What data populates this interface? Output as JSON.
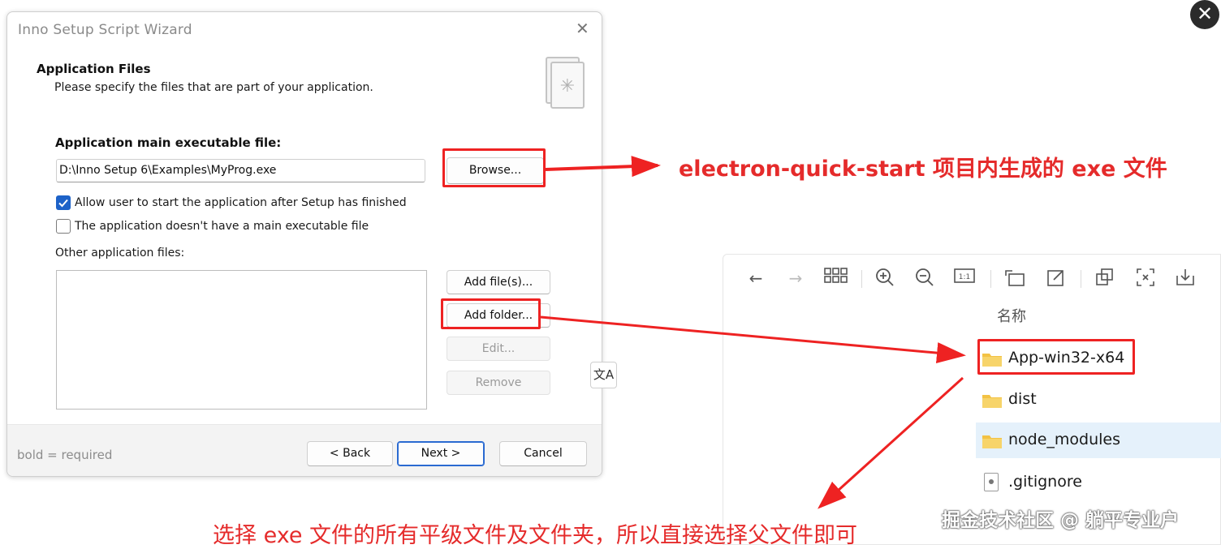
{
  "dialog": {
    "title": "Inno Setup Script Wizard",
    "close_glyph": "✕",
    "section_title": "Application Files",
    "section_subtitle": "Please specify the files that are part of your application.",
    "main_exe_label": "Application main executable file:",
    "main_exe_value": "D:\\Inno Setup 6\\Examples\\MyProg.exe",
    "browse_label": "Browse...",
    "allow_start_label": "Allow user to start the application after Setup has finished",
    "allow_start_checked": true,
    "no_main_exe_label": "The application doesn't have a main executable file",
    "no_main_exe_checked": false,
    "other_files_label": "Other application files:",
    "add_files_label": "Add file(s)...",
    "add_folder_label": "Add folder...",
    "edit_label": "Edit...",
    "remove_label": "Remove",
    "footer_hint": "bold = required",
    "back_label": "< Back",
    "next_label": "Next >",
    "cancel_label": "Cancel"
  },
  "translate_chip": "文A",
  "close_overlay_glyph": "✕",
  "annotations": {
    "browse_note": "electron-quick-start 项目内生成的 exe 文件",
    "folder_note": "选择 exe 文件的所有平级文件及文件夹，所以直接选择父文件即可"
  },
  "explorer": {
    "column_header": "名称",
    "toolbar_icons": [
      "back-icon",
      "forward-icon",
      "grid-view-icon",
      "zoom-in-icon",
      "zoom-out-icon",
      "actual-size-icon",
      "rotate-icon",
      "edit-icon",
      "copy-icon",
      "fit-icon",
      "download-icon"
    ],
    "items": [
      {
        "name": "App-win32-x64",
        "type": "folder",
        "selected": false
      },
      {
        "name": "dist",
        "type": "folder",
        "selected": false
      },
      {
        "name": "node_modules",
        "type": "folder",
        "selected": true
      },
      {
        "name": ".gitignore",
        "type": "file",
        "selected": false
      }
    ]
  },
  "watermark": "掘金技术社区 @ 躺平专业户",
  "colors": {
    "accent_red": "#ee2222",
    "checkbox_blue": "#1d62c8",
    "folder_yellow": "#f3c244",
    "selection_blue": "#e5f1fb"
  }
}
